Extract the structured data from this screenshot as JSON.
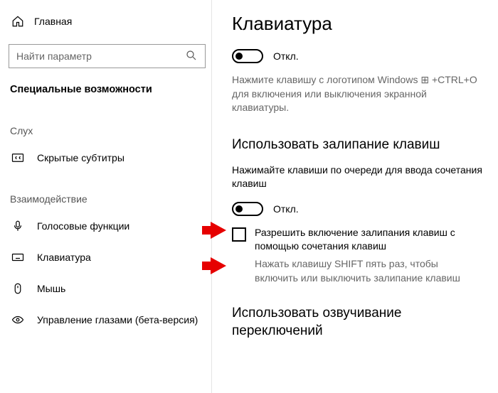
{
  "sidebar": {
    "home": "Главная",
    "search_placeholder": "Найти параметр",
    "section": "Специальные возможности",
    "group_hearing": "Слух",
    "item_cc": "Скрытые субтитры",
    "group_interaction": "Взаимодействие",
    "item_speech": "Голосовые функции",
    "item_keyboard": "Клавиатура",
    "item_mouse": "Мышь",
    "item_eye": "Управление глазами (бета-версия)"
  },
  "main": {
    "title": "Клавиатура",
    "osk_toggle": "Откл.",
    "osk_desc": "Нажмите клавишу с логотипом Windows ⊞ +CTRL+O для включения или выключения экранной клавиатуры.",
    "sticky_heading": "Использовать залипание клавиш",
    "sticky_desc": "Нажимайте клавиши по очереди для ввода сочетания клавиш",
    "sticky_toggle": "Откл.",
    "sticky_checkbox_label": "Разрешить включение залипания клавиш с помощью сочетания клавиш",
    "sticky_hint": "Нажать клавишу SHIFT пять раз, чтобы включить или выключить залипание клавиш",
    "togglekeys_heading": "Использовать озвучивание переключений"
  }
}
